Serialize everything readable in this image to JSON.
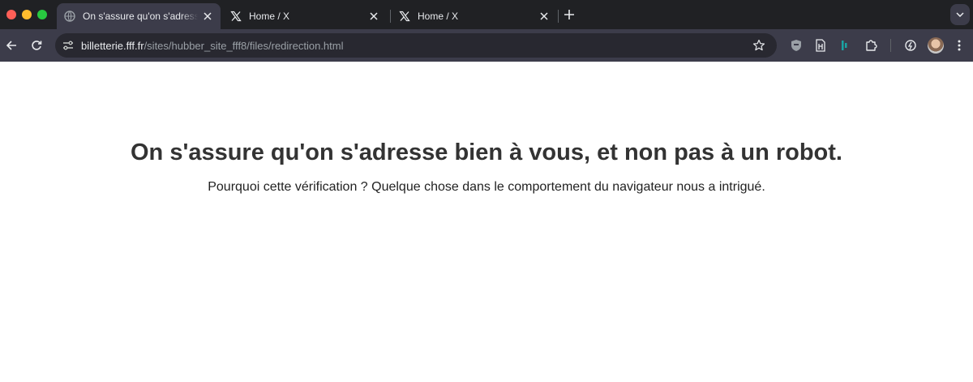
{
  "window": {
    "traffic_lights": [
      "close",
      "minimize",
      "maximize"
    ]
  },
  "tabs": [
    {
      "title": "On s'assure qu'on s'adresse bien à vous, et non pas à un robot.",
      "favicon": "globe-icon",
      "active": true
    },
    {
      "title": "Home / X",
      "favicon": "x-logo-icon",
      "active": false
    },
    {
      "title": "Home / X",
      "favicon": "x-logo-icon",
      "active": false
    }
  ],
  "toolbar": {
    "url_host": "billetterie.fff.fr",
    "url_path": "/sites/hubber_site_fff8/files/redirection.html",
    "extensions": [
      "shield-extension-icon",
      "document-extension-icon",
      "teal-extension-icon",
      "puzzle-extensions-icon",
      "performance-icon"
    ]
  },
  "page": {
    "heading": "On s'assure qu'on s'adresse bien à vous, et non pas à un robot.",
    "subtext": "Pourquoi cette vérification ? Quelque chose dans le comportement du navigateur nous a intrigué."
  },
  "colors": {
    "tabstrip": "#202124",
    "toolbar": "#3c3c4a",
    "omnibox": "#282830",
    "heading": "#333333"
  }
}
